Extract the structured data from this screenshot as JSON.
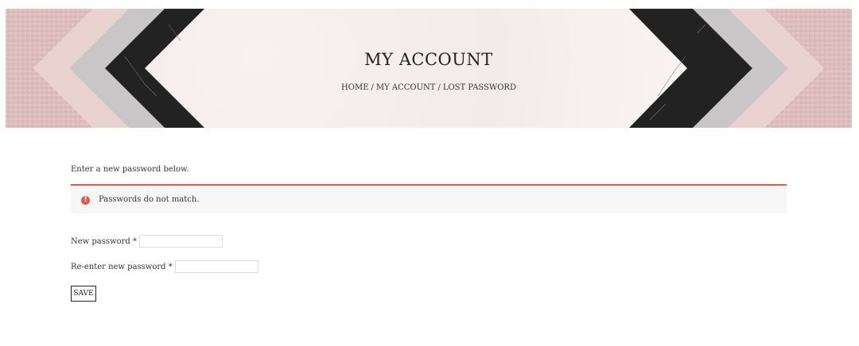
{
  "header": {
    "title": "MY ACCOUNT",
    "breadcrumb": {
      "home": "HOME",
      "sep1": "/",
      "my_account": "MY ACCOUNT",
      "sep2": "/",
      "current": "LOST PASSWORD"
    }
  },
  "form": {
    "intro": "Enter a new password below.",
    "error": {
      "icon": "exclamation-circle-icon",
      "icon_glyph": "!",
      "message": "Passwords do not match.",
      "accent_color": "#e2574c"
    },
    "new_password_label": "New password *",
    "new_password_value": "",
    "reenter_password_label": "Re-enter new password *",
    "reenter_password_value": "",
    "save_label": "SAVE"
  },
  "colors": {
    "glitter_pink": "#dcbcbc",
    "blush": "#e9d2cf",
    "grey": "#c9c6c8",
    "black_marble": "#222222"
  }
}
